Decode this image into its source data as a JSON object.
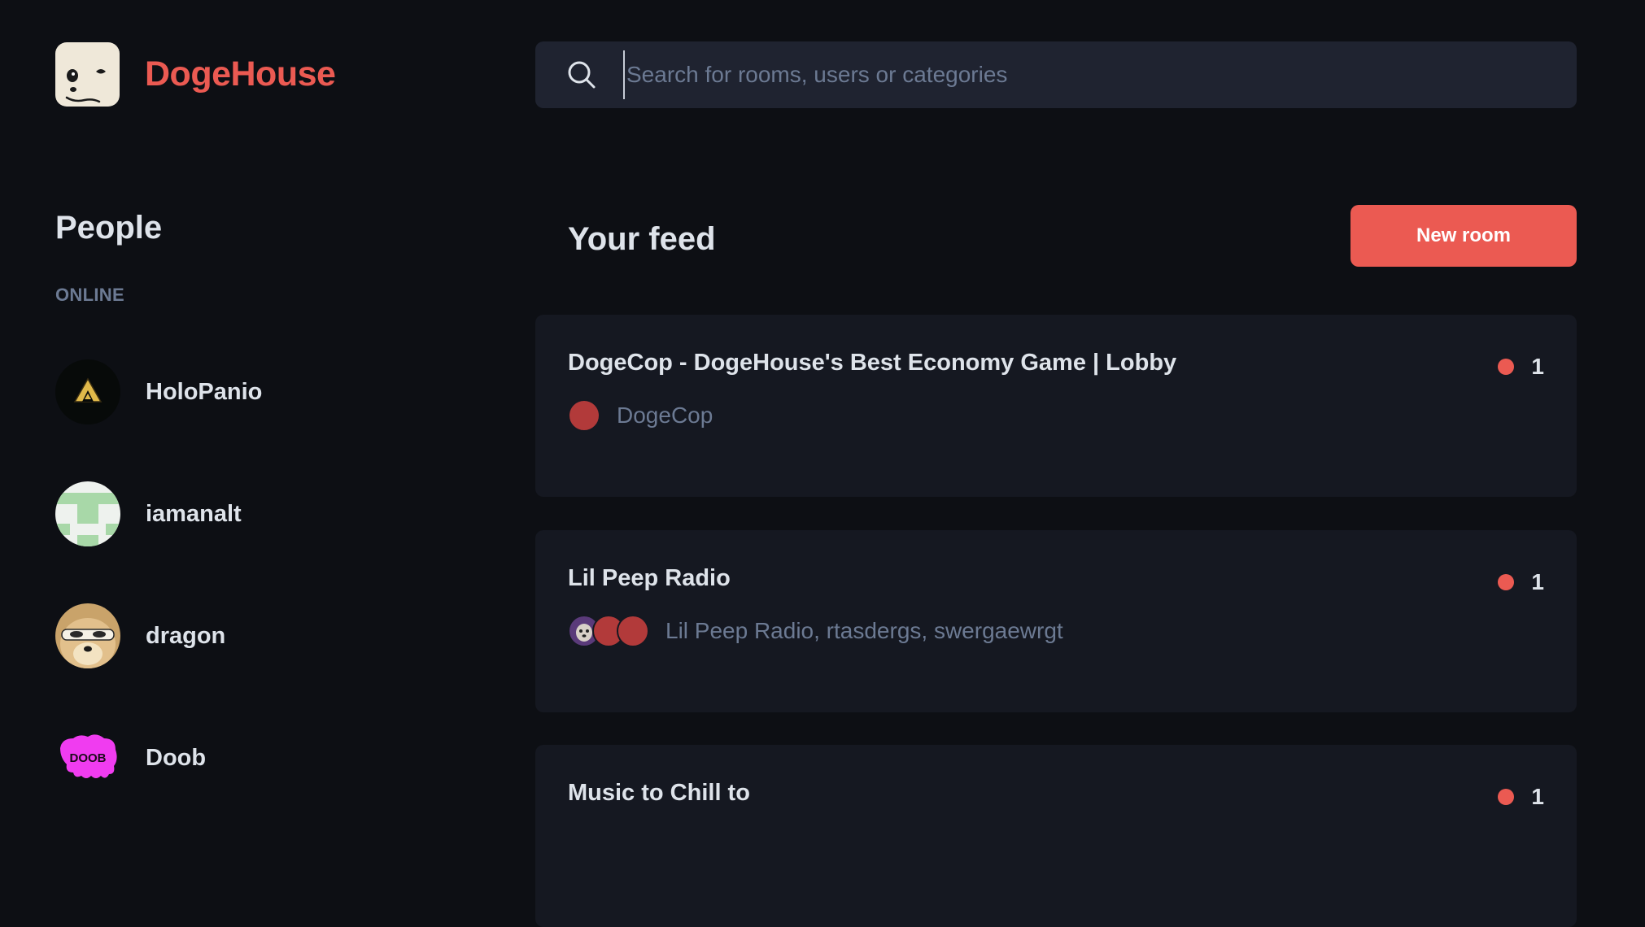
{
  "app": {
    "name": "DogeHouse",
    "brand_color": "#eb5a52"
  },
  "search": {
    "placeholder": "Search for rooms, users or categories",
    "value": ""
  },
  "people": {
    "title": "People",
    "online_label": "ONLINE",
    "users": [
      {
        "name": "HoloPanio",
        "avatar": "triforce-avatar"
      },
      {
        "name": "iamanalt",
        "avatar": "green-pixel-avatar"
      },
      {
        "name": "dragon",
        "avatar": "doge-sunglasses-avatar"
      },
      {
        "name": "Doob",
        "avatar": "doob-logo-avatar"
      }
    ]
  },
  "feed": {
    "title": "Your feed",
    "new_room_label": "New room",
    "rooms": [
      {
        "title": "DogeCop - DogeHouse's Best Economy Game | Lobby",
        "speakers": "DogeCop",
        "listener_count": "1"
      },
      {
        "title": "Lil Peep Radio",
        "speakers": "Lil Peep Radio, rtasdergs, swergaewrgt",
        "listener_count": "1"
      },
      {
        "title": "Music to Chill to",
        "speakers": "",
        "listener_count": "1"
      }
    ]
  },
  "colors": {
    "background": "#0d0f14",
    "card": "#151821",
    "search_bg": "#1f2330",
    "muted_text": "#6c7a93",
    "live_dot": "#eb5a52",
    "speaker_avatar": "#b23a3a"
  }
}
